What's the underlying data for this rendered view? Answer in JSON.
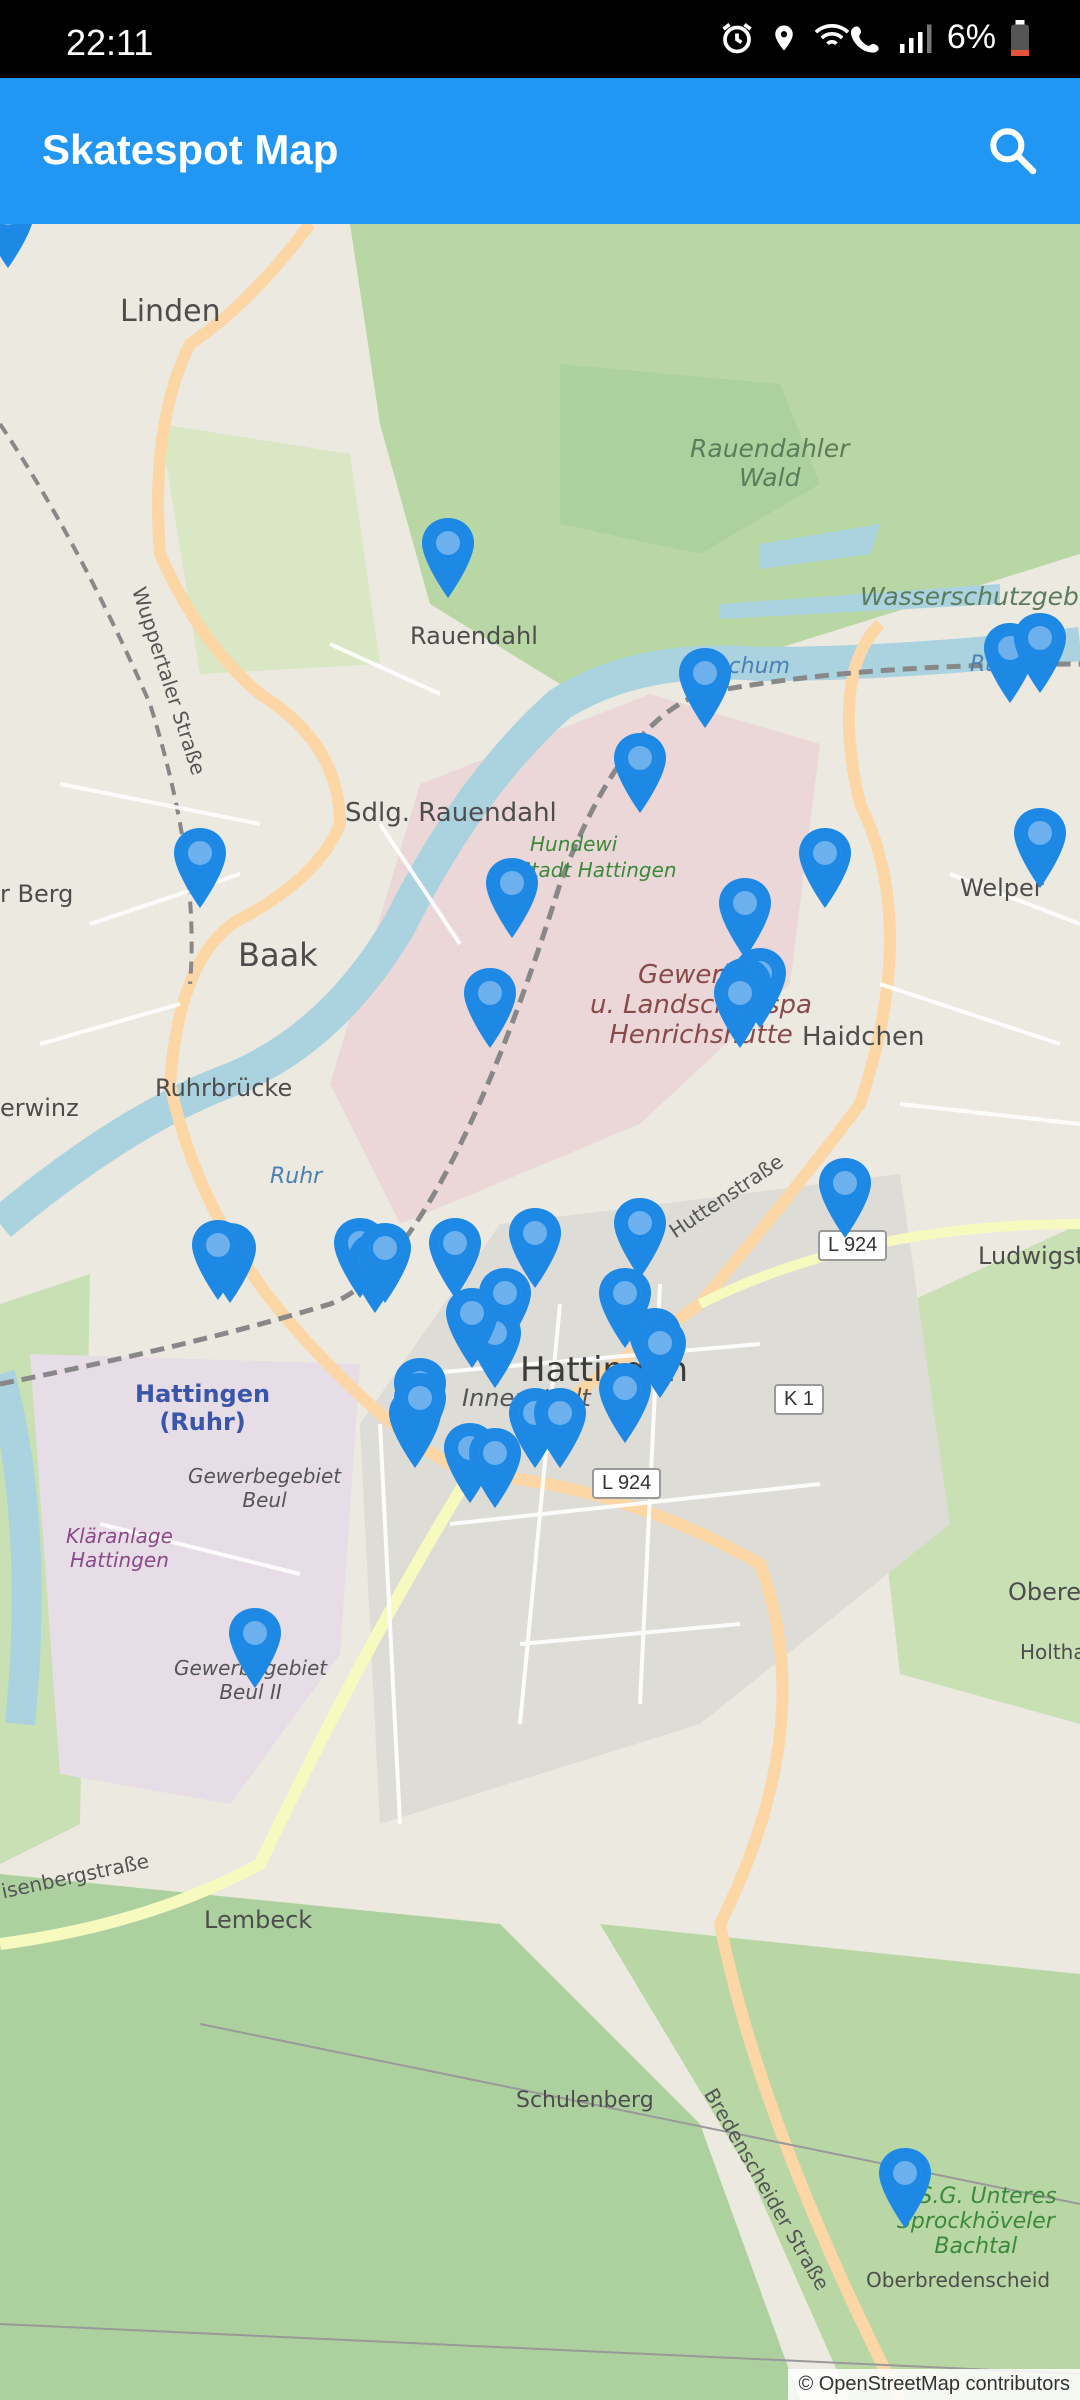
{
  "status_bar": {
    "time": "22:11",
    "battery": "6%",
    "icons": [
      "alarm-icon",
      "location-icon",
      "wifi-call-icon",
      "signal-icon",
      "battery-icon"
    ]
  },
  "app_bar": {
    "title": "Skatespot Map",
    "search_icon": "search-icon"
  },
  "map": {
    "places": {
      "linden": "Linden",
      "rauendahler_wald": "Rauendahler\nWald",
      "wasserschutzgebiet": "Wasserschutzgebiet",
      "bochum": "Bochum",
      "ruhr1": "Ruhr",
      "rauendahl": "Rauendahl",
      "sdlg_rauendahl": "Sdlg. Rauendahl",
      "hundewiese": "Hundewi",
      "stadt_hattingen": "Stadt Hattingen",
      "welper": "Welper",
      "berg": "r Berg",
      "baak": "Baak",
      "gewerbe": "Gewerbe-\nu. Landschaftspa\nHenrichshütte",
      "haidchen": "Haidchen",
      "ruhrbrucke": "Ruhrbrücke",
      "erwinz": "erwinz",
      "ruhr2": "Ruhr",
      "ludwigsta": "Ludwigsta",
      "hattingen": "Hattingen",
      "innenstadt": "Innenstadt",
      "hattingen_ruhr": "Hattingen\n(Ruhr)",
      "gewerbegebiet_beul": "Gewerbegebiet\nBeul",
      "klaranlage": "Kläranlage\nHattingen",
      "gewerbegebiet_beul2": "Gewerbegebiet\nBeul II",
      "obere": "Obere",
      "holtha": "Holtha",
      "lembeck": "Lembeck",
      "isenbergstrasse": "isenbergstraße",
      "schulenberg": "Schulenberg",
      "bredenscheider": "Bredenscheider Straße",
      "nsg": "N.S.G. Unteres\nSprockhöveler\nBachtal",
      "oberbredenscheid": "Oberbredenscheid",
      "wuppertaler": "Wuppertaler Straße",
      "huttenstrasse": "Huttenstraße",
      "l924a": "L 924",
      "l924b": "L 924",
      "k1": "K 1"
    },
    "attribution": "© OpenStreetMap contributors",
    "marker_color": "#1e88e5",
    "marker_icon": "map-pin-icon",
    "marker_count": 40
  },
  "colors": {
    "app_bar": "#2196f3",
    "status_bar": "#000000"
  }
}
